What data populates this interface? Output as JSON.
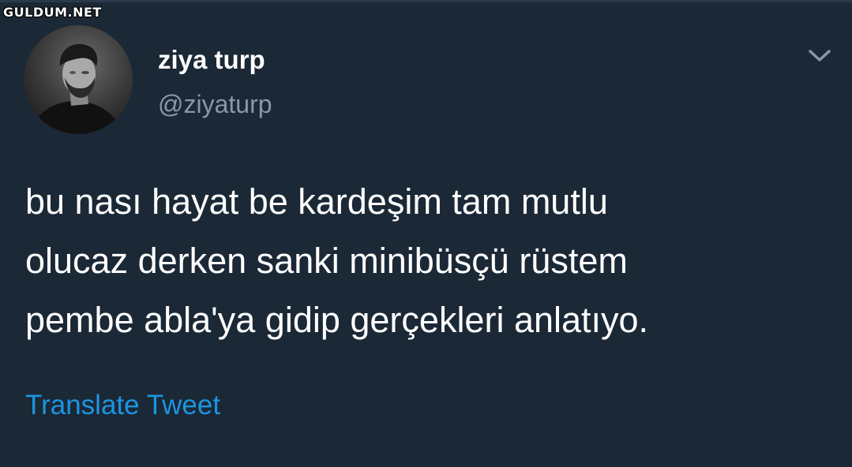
{
  "watermark": "GULDUM.NET",
  "tweet": {
    "author": {
      "display_name": "ziya turp",
      "handle": "@ziyaturp"
    },
    "text_lines": [
      "bu nası hayat be kardeşim tam mutlu",
      "olucaz derken sanki minibüsçü rüstem",
      "pembe abla'ya gidip gerçekleri anlatıyo."
    ],
    "translate_label": "Translate Tweet",
    "menu_icon": "chevron-down-icon"
  },
  "colors": {
    "background": "#1b2836",
    "text": "#ffffff",
    "handle": "#8899a6",
    "link": "#1b95e0"
  }
}
